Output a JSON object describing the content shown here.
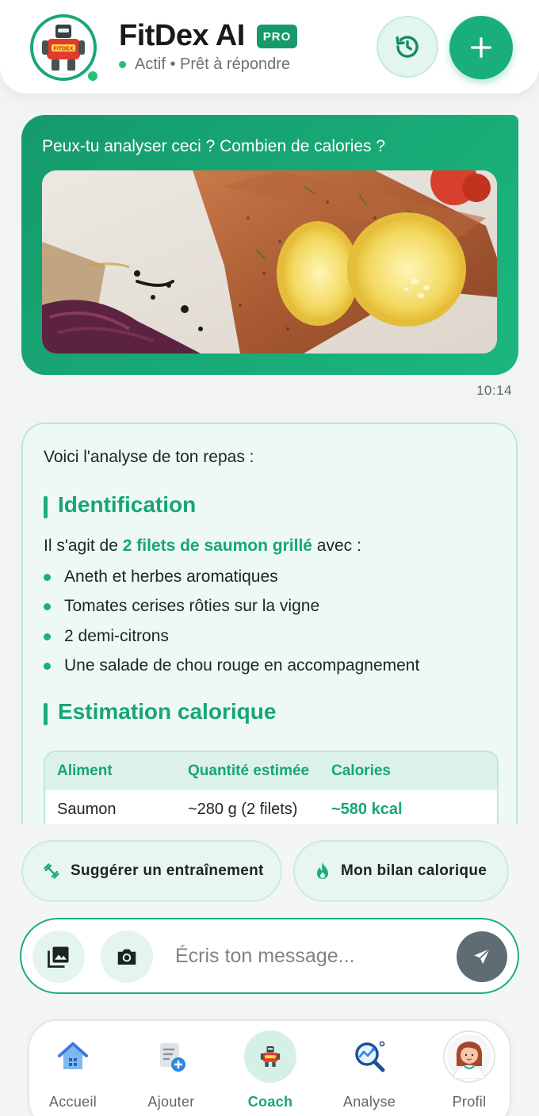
{
  "header": {
    "title": "FitDex AI",
    "badge": "PRO",
    "status": "Actif • Prêt à répondre",
    "avatar_text": "FITDEX",
    "history_icon": "history-icon",
    "add_icon": "plus-icon"
  },
  "chat": {
    "user_message": {
      "text": "Peux-tu analyser ceci ? Combien de calories ?",
      "image": "grilled-salmon-photo",
      "time": "10:14"
    },
    "ai_message": {
      "intro": "Voici l'analyse de ton repas :",
      "section1_title": "Identification",
      "ident_prefix": "Il s'agit de ",
      "ident_highlight": "2 filets de saumon grillé",
      "ident_suffix": " avec :",
      "items": [
        "Aneth et herbes aromatiques",
        "Tomates cerises rôties sur la vigne",
        "2 demi-citrons",
        "Une salade de chou rouge en accompagnement"
      ],
      "section2_title": "Estimation calorique",
      "table": {
        "headers": [
          "Aliment",
          "Quantité estimée",
          "Calories"
        ],
        "rows": [
          [
            "Saumon",
            "~280 g (2 filets)",
            "~580 kcal"
          ]
        ]
      }
    }
  },
  "suggestions": [
    {
      "label": "Suggérer un entraînement",
      "icon": "dumbbell-icon"
    },
    {
      "label": "Mon bilan calorique",
      "icon": "flame-icon"
    }
  ],
  "composer": {
    "placeholder": "Écris ton message...",
    "gallery_icon": "gallery-icon",
    "camera_icon": "camera-icon",
    "send_icon": "send-icon"
  },
  "nav": [
    {
      "label": "Accueil",
      "icon": "home-icon",
      "active": false
    },
    {
      "label": "Ajouter",
      "icon": "add-document-icon",
      "active": false
    },
    {
      "label": "Coach",
      "icon": "robot-coach-icon",
      "active": true
    },
    {
      "label": "Analyse",
      "icon": "analysis-magnifier-icon",
      "active": false
    },
    {
      "label": "Profil",
      "icon": "profile-avatar-icon",
      "active": false
    }
  ],
  "colors": {
    "accent": "#1aaf7a",
    "accent_dark": "#159a6c",
    "send_button": "#5f6c74",
    "background": "#f1f4f3"
  }
}
